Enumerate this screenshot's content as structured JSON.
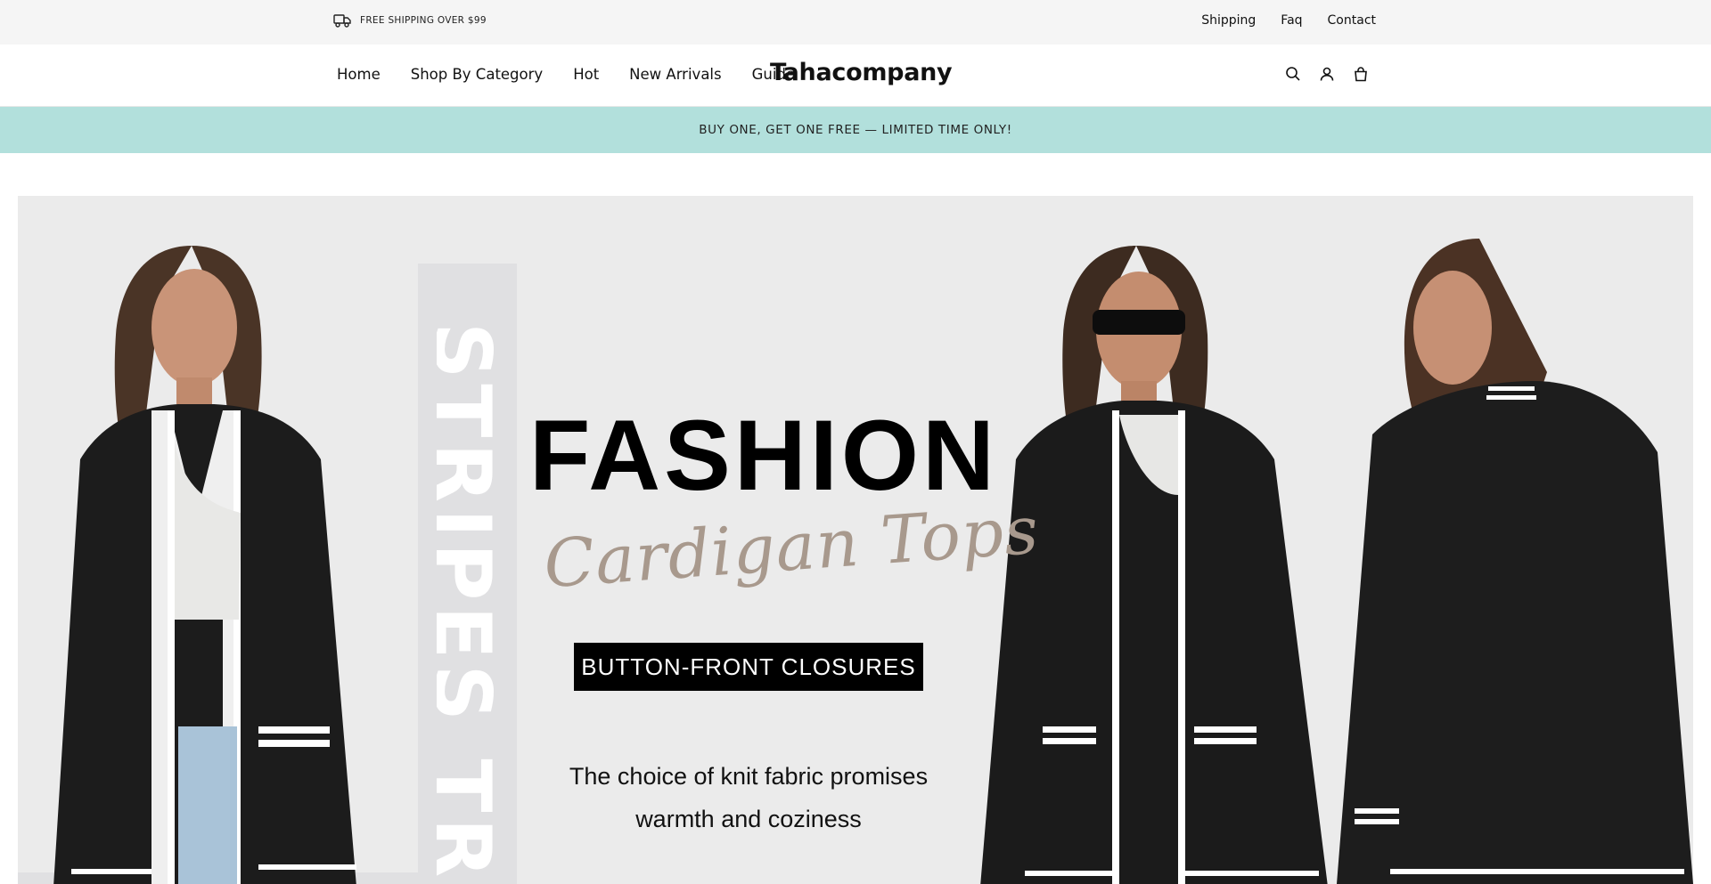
{
  "topbar": {
    "shipping_notice": "FREE SHIPPING OVER $99",
    "links": [
      "Shipping",
      "Faq",
      "Contact"
    ]
  },
  "nav": {
    "menu": [
      "Home",
      "Shop By Category",
      "Hot",
      "New Arrivals",
      "Guide"
    ],
    "logo": "Tahacompany",
    "icons": [
      "search-icon",
      "account-icon",
      "cart-icon"
    ]
  },
  "promo": {
    "text": "BUY ONE, GET ONE FREE — LIMITED TIME ONLY!"
  },
  "hero": {
    "vertical_word": "STRIPES TR",
    "title": "FASHION",
    "script_title": "Cardigan Tops",
    "cta": "BUTTON-FRONT CLOSURES",
    "desc_line1": "The choice of knit fabric promises",
    "desc_line2": "warmth and coziness"
  },
  "colors": {
    "topbar_bg": "#f5f5f5",
    "promo_bg": "#b2e0dc",
    "hero_bg": "#ebebeb",
    "script_color": "#a8998d",
    "cta_bg": "#000000"
  }
}
